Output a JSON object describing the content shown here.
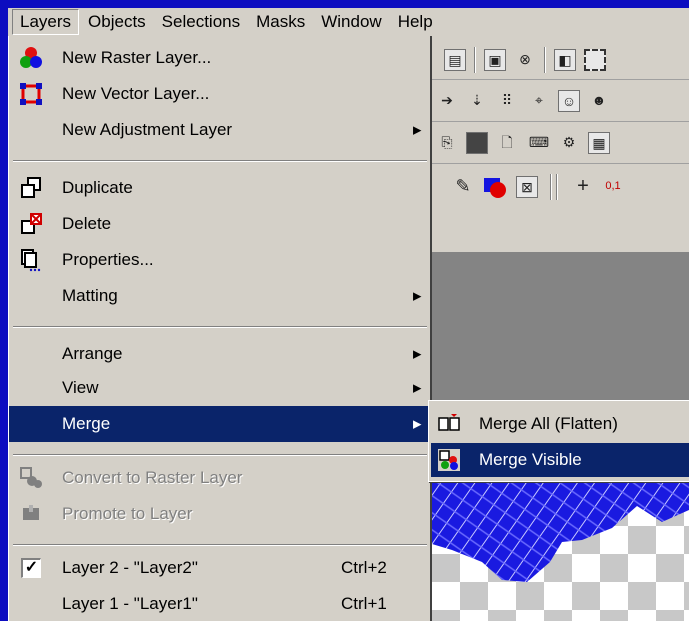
{
  "menubar": {
    "items": [
      {
        "label": "Layers",
        "mnemonic": "L",
        "active": true
      },
      {
        "label": "Objects",
        "mnemonic": "O"
      },
      {
        "label": "Selections",
        "mnemonic": "S"
      },
      {
        "label": "Masks",
        "mnemonic": "M"
      },
      {
        "label": "Window",
        "mnemonic": "W"
      },
      {
        "label": "Help",
        "mnemonic": "H"
      }
    ]
  },
  "layers_menu": {
    "new_raster_layer": "New Raster Layer...",
    "new_vector_layer": "New Vector Layer...",
    "new_adjustment_layer": "New Adjustment Layer",
    "duplicate": "Duplicate",
    "delete": "Delete",
    "properties": "Properties...",
    "matting": "Matting",
    "arrange": "Arrange",
    "view": "View",
    "merge": "Merge",
    "convert_to_raster": "Convert to Raster Layer",
    "promote_to_layer": "Promote to Layer",
    "layer2": "Layer 2 - \"Layer2\"",
    "layer2_shortcut": "Ctrl+2",
    "layer1": "Layer 1 - \"Layer1\"",
    "layer1_shortcut": "Ctrl+1"
  },
  "merge_submenu": {
    "merge_all": "Merge All (Flatten)",
    "merge_visible": "Merge Visible"
  },
  "colors": {
    "selection": "#0a246a",
    "menu_bg": "#d4d0c8",
    "desktop": "#0a0ab8"
  }
}
